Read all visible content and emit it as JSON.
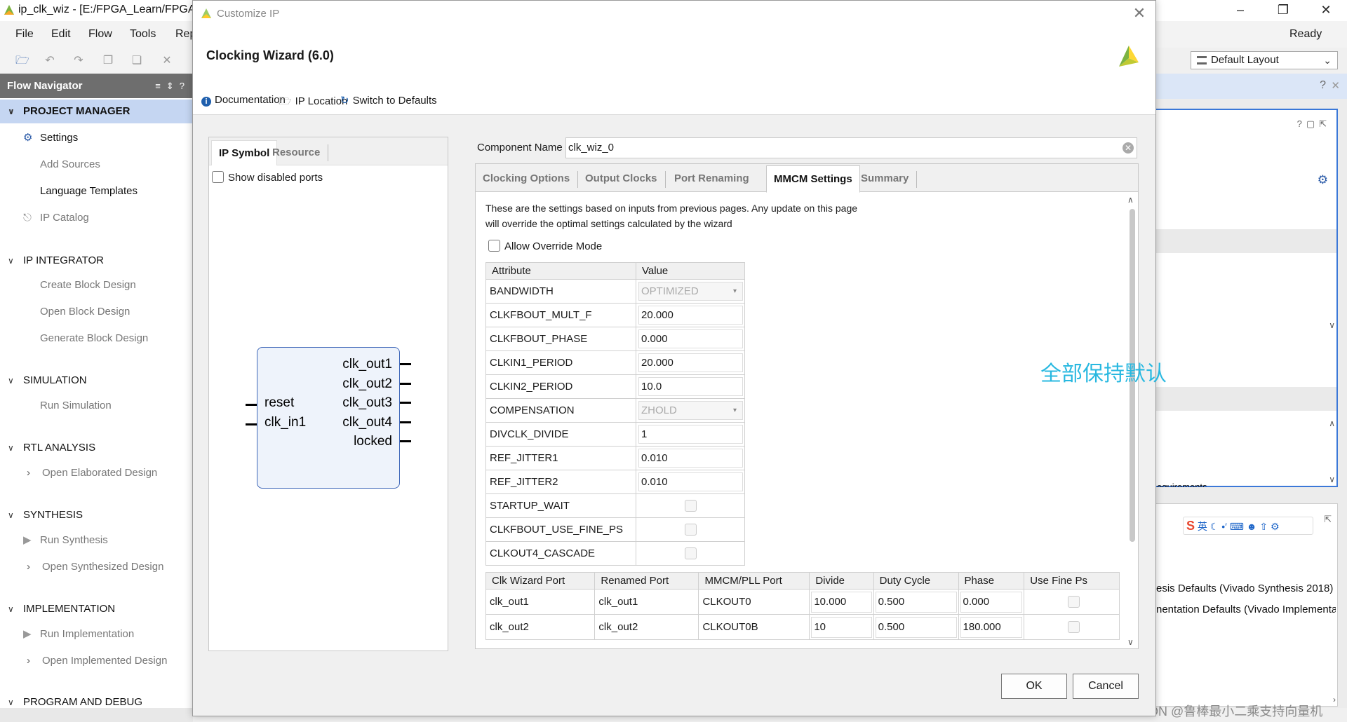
{
  "main_window": {
    "title": "ip_clk_wiz - [E:/FPGA_Learn/FPGA/",
    "menu": [
      "File",
      "Edit",
      "Flow",
      "Tools",
      "Rep"
    ],
    "status": "Ready",
    "layout_select": "Default Layout"
  },
  "flow_navigator": {
    "title": "Flow Navigator",
    "sections": [
      {
        "label": "PROJECT MANAGER",
        "items": [
          "Settings",
          "Add Sources",
          "Language Templates",
          "IP Catalog"
        ]
      },
      {
        "label": "IP INTEGRATOR",
        "items": [
          "Create Block Design",
          "Open Block Design",
          "Generate Block Design"
        ]
      },
      {
        "label": "SIMULATION",
        "items": [
          "Run Simulation"
        ]
      },
      {
        "label": "RTL ANALYSIS",
        "items": [
          "Open Elaborated Design"
        ]
      },
      {
        "label": "SYNTHESIS",
        "items": [
          "Run Synthesis",
          "Open Synthesized Design"
        ]
      },
      {
        "label": "IMPLEMENTATION",
        "items": [
          "Run Implementation",
          "Open Implemented Design"
        ]
      },
      {
        "label": "PROGRAM AND DEBUG",
        "items": []
      }
    ]
  },
  "right_panel": {
    "text_requirements": "equirements",
    "synth_defaults": "esis Defaults (Vivado Synthesis 2018)",
    "impl_defaults": "nentation Defaults (Vivado Implementatic",
    "ime_label": "英",
    "watermark": "CSDN @鲁棒最小二乘支持向量机"
  },
  "dialog": {
    "title": "Customize IP",
    "heading": "Clocking Wizard (6.0)",
    "links": [
      "Documentation",
      "IP Location",
      "Switch to Defaults"
    ],
    "left_tabs": [
      "IP Symbol",
      "Resource"
    ],
    "show_disabled": "Show disabled ports",
    "ports_left": [
      "reset",
      "clk_in1"
    ],
    "ports_right": [
      "clk_out1",
      "clk_out2",
      "clk_out3",
      "clk_out4",
      "locked"
    ],
    "component_name_label": "Component Name",
    "component_name": "clk_wiz_0",
    "tabs": [
      "Clocking Options",
      "Output Clocks",
      "Port Renaming",
      "MMCM Settings",
      "Summary"
    ],
    "active_tab": "MMCM Settings",
    "info_line1": "These are the settings based on inputs from previous pages. Any update on this page",
    "info_line2": "will override the optimal settings calculated by the wizard",
    "allow_override": "Allow Override Mode",
    "attr_headers": [
      "Attribute",
      "Value"
    ],
    "attributes": [
      {
        "name": "BANDWIDTH",
        "value": "OPTIMIZED",
        "kind": "dropdown"
      },
      {
        "name": "CLKFBOUT_MULT_F",
        "value": "20.000",
        "kind": "text"
      },
      {
        "name": "CLKFBOUT_PHASE",
        "value": "0.000",
        "kind": "text"
      },
      {
        "name": "CLKIN1_PERIOD",
        "value": "20.000",
        "kind": "text"
      },
      {
        "name": "CLKIN2_PERIOD",
        "value": "10.0",
        "kind": "text"
      },
      {
        "name": "COMPENSATION",
        "value": "ZHOLD",
        "kind": "dropdown"
      },
      {
        "name": "DIVCLK_DIVIDE",
        "value": "1",
        "kind": "text"
      },
      {
        "name": "REF_JITTER1",
        "value": "0.010",
        "kind": "text"
      },
      {
        "name": "REF_JITTER2",
        "value": "0.010",
        "kind": "text"
      },
      {
        "name": "STARTUP_WAIT",
        "value": "",
        "kind": "checkbox"
      },
      {
        "name": "CLKFBOUT_USE_FINE_PS",
        "value": "",
        "kind": "checkbox"
      },
      {
        "name": "CLKOUT4_CASCADE",
        "value": "",
        "kind": "checkbox"
      }
    ],
    "port_headers": [
      "Clk Wizard Port",
      "Renamed Port",
      "MMCM/PLL Port",
      "Divide",
      "Duty Cycle",
      "Phase",
      "Use Fine Ps"
    ],
    "port_rows": [
      [
        "clk_out1",
        "clk_out1",
        "CLKOUT0",
        "10.000",
        "0.500",
        "0.000"
      ],
      [
        "clk_out2",
        "clk_out2",
        "CLKOUT0B",
        "10",
        "0.500",
        "180.000"
      ]
    ],
    "note": "全部保持默认",
    "ok": "OK",
    "cancel": "Cancel"
  }
}
